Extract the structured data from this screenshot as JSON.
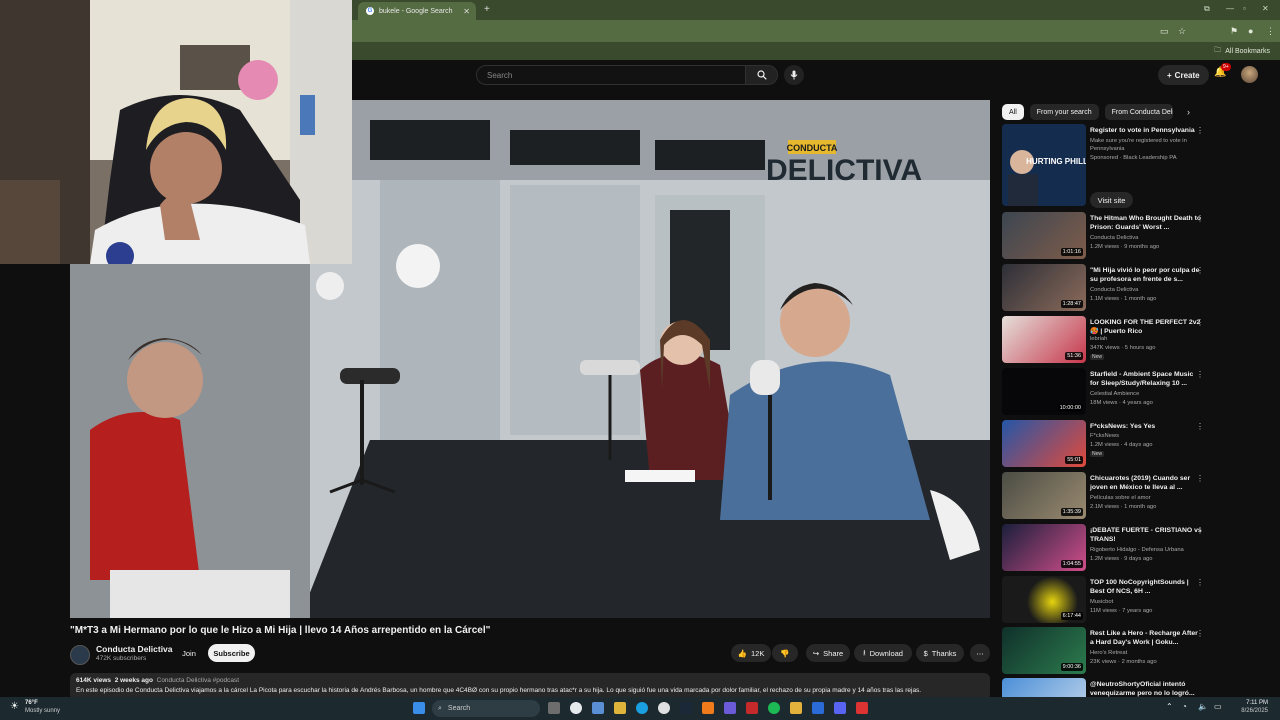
{
  "browser": {
    "tab_title": "bukele - Google Search",
    "bookmarks_label": "All Bookmarks"
  },
  "youtube": {
    "search_placeholder": "Search",
    "create_label": "Create",
    "notifications_count": "9+"
  },
  "video": {
    "logo_top": "CONDUCTA",
    "logo_bottom": "DELICTIVA",
    "title": "\"M*T3 a Mi Hermano por lo que le Hizo a Mi Hija | llevo 14 Años arrepentido en la Cárcel\"",
    "channel": "Conducta Delictiva",
    "subscribers": "472K subscribers",
    "join_label": "Join",
    "subscribe_label": "Subscribe",
    "likes": "12K",
    "share_label": "Share",
    "download_label": "Download",
    "thanks_label": "Thanks",
    "views": "614K views",
    "age": "2 weeks ago",
    "tags": "Conducta Delictiva #podcast",
    "description": "En este episodio de Conducta Delictiva viajamos a la cárcel La Picota para escuchar la historia de Andrés Barbosa, un hombre que 4C4BØ con su propio hermano tras atac*r a su hija. Lo que siguió fue una vida marcada por dolor familiar, el rechazo de su propia madre y 14 años tras las rejas."
  },
  "sidebar": {
    "chips": [
      "All",
      "From your search",
      "From Conducta Delictiva"
    ],
    "items": [
      {
        "title": "Register to vote in Pennsylvania",
        "line2": "Make sure you're registered to vote in Pennsylvania",
        "line3": "Sponsored · Black Leadership PA",
        "cta": "Visit site",
        "thumb_text": "HURTING PHILLY."
      },
      {
        "title": "The Hitman Who Brought Death to Prison: Guards' Worst ...",
        "channel": "Conducta Delictiva",
        "meta": "1.2M views · 9 months ago",
        "duration": "1:01:16"
      },
      {
        "title": "\"Mi Hija vivió lo peor por culpa de su profesora en frente de s...",
        "channel": "Conducta Delictiva",
        "meta": "1.1M views · 1 month ago",
        "duration": "1:28:47"
      },
      {
        "title": "LOOKING FOR THE PERFECT 2v2 🥵 | Puerto Rico",
        "channel": "lebriah",
        "meta": "347K views · 5 hours ago",
        "badge": "New",
        "duration": "51:36"
      },
      {
        "title": "Starfield - Ambient Space Music for Sleep/Study/Relaxing 10 ...",
        "channel": "Celestial Ambience",
        "meta": "18M views · 4 years ago",
        "duration": "10:00:00"
      },
      {
        "title": "F*cksNews: Yes Yes",
        "channel": "F*cksNews",
        "meta": "1.2M views · 4 days ago",
        "badge": "New",
        "duration": "55:01"
      },
      {
        "title": "Chicuarotes (2019) Cuando ser joven en México te lleva al ...",
        "channel": "Películas sobre el amor",
        "meta": "2.1M views · 1 month ago",
        "duration": "1:35:39"
      },
      {
        "title": "¡DEBATE FUERTE - CRISTIANO vs TRANS!",
        "channel": "Rigoberto Hidalgo - Defensa Urbana",
        "meta": "1.2M views · 9 days ago",
        "duration": "1:04:55"
      },
      {
        "title": "TOP 100 NoCopyrightSounds | Best Of NCS, 6H ...",
        "channel": "Musicbot",
        "meta": "11M views · 7 years ago",
        "duration": "6:17:44"
      },
      {
        "title": "Rest Like a Hero - Recharge After a Hard Day's Work | Goku...",
        "channel": "Hero's Retreat",
        "meta": "23K views · 2 months ago",
        "duration": "9:00:36"
      },
      {
        "title": "@NeutroShortyOficial intentó venequizarme pero no lo logró...",
        "channel": "",
        "meta": "",
        "duration": ""
      }
    ]
  },
  "taskbar": {
    "weather_temp": "76°F",
    "weather_desc": "Mostly sunny",
    "search_label": "Search",
    "time": "7:11 PM",
    "date": "8/26/2025"
  }
}
